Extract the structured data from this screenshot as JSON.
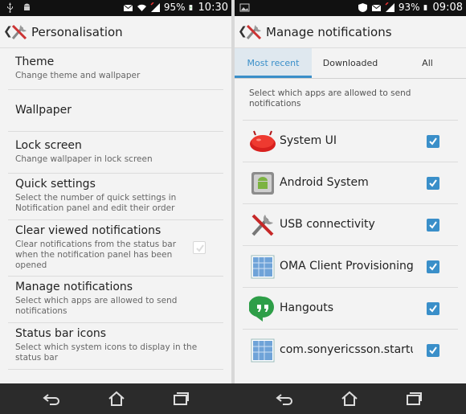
{
  "left": {
    "status": {
      "battery": "95%",
      "time": "10:30"
    },
    "title": "Personalisation",
    "items": [
      {
        "title": "Theme",
        "summary": "Change theme and wallpaper"
      },
      {
        "title": "Wallpaper",
        "summary": ""
      },
      {
        "title": "Lock screen",
        "summary": "Change wallpaper in lock screen"
      },
      {
        "title": "Quick settings",
        "summary": "Select the number of quick settings in Notification panel and edit their order"
      },
      {
        "title": "Clear viewed notifications",
        "summary": "Clear notifications from the status bar when the notification panel has been opened",
        "checked": true,
        "enabled": false
      },
      {
        "title": "Manage notifications",
        "summary": "Select which apps are allowed to send notifications"
      },
      {
        "title": "Status bar icons",
        "summary": "Select which system icons to display in the status bar"
      }
    ]
  },
  "right": {
    "status": {
      "battery": "93%",
      "time": "09:08"
    },
    "title": "Manage notifications",
    "tabs": [
      "Most recent",
      "Downloaded",
      "All"
    ],
    "active_tab": "Most recent",
    "description": "Select which apps are allowed to send notifications",
    "apps": [
      {
        "name": "System UI",
        "icon": "system-ui-icon",
        "checked": true
      },
      {
        "name": "Android System",
        "icon": "android-system-icon",
        "checked": true
      },
      {
        "name": "USB connectivity",
        "icon": "usb-tools-icon",
        "checked": true
      },
      {
        "name": "OMA Client Provisioning",
        "icon": "oma-client-icon",
        "checked": true
      },
      {
        "name": "Hangouts",
        "icon": "hangouts-icon",
        "checked": true
      },
      {
        "name": "com.sonyericsson.startupflagservice",
        "icon": "generic-app-icon",
        "checked": true
      }
    ]
  },
  "colors": {
    "accent": "#3a8fc9",
    "statusbar": "#111111",
    "navbar": "#2b2b2b"
  }
}
